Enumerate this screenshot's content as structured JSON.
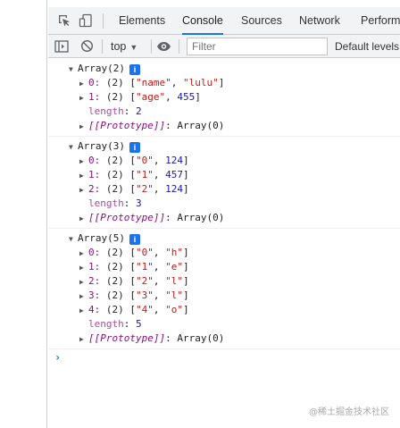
{
  "tabs": {
    "elements": "Elements",
    "console": "Console",
    "sources": "Sources",
    "network": "Network",
    "performance": "Perform"
  },
  "toolbar": {
    "context": "top",
    "filter_placeholder": "Filter",
    "levels": "Default levels"
  },
  "log1": {
    "header": "Array(2)",
    "info": "i",
    "item0": {
      "index": "0:",
      "count": " (2) [",
      "a": "\"name\"",
      "sep": ", ",
      "b": "\"lulu\"",
      "close": "]"
    },
    "item1": {
      "index": "1:",
      "count": " (2) [",
      "a": "\"age\"",
      "sep": ", ",
      "b": "455",
      "close": "]"
    },
    "length_key": "length",
    "colon": ": ",
    "length_val": "2",
    "proto_key": "[[Prototype]]",
    "proto_val": ": Array(0)"
  },
  "log2": {
    "header": "Array(3)",
    "info": "i",
    "item0": {
      "index": "0:",
      "count": " (2) [",
      "a": "\"0\"",
      "sep": ", ",
      "b": "124",
      "close": "]"
    },
    "item1": {
      "index": "1:",
      "count": " (2) [",
      "a": "\"1\"",
      "sep": ", ",
      "b": "457",
      "close": "]"
    },
    "item2": {
      "index": "2:",
      "count": " (2) [",
      "a": "\"2\"",
      "sep": ", ",
      "b": "124",
      "close": "]"
    },
    "length_key": "length",
    "colon": ": ",
    "length_val": "3",
    "proto_key": "[[Prototype]]",
    "proto_val": ": Array(0)"
  },
  "log3": {
    "header": "Array(5)",
    "info": "i",
    "item0": {
      "index": "0:",
      "count": " (2) [",
      "a": "\"0\"",
      "sep": ", ",
      "b": "\"h\"",
      "close": "]"
    },
    "item1": {
      "index": "1:",
      "count": " (2) [",
      "a": "\"1\"",
      "sep": ", ",
      "b": "\"e\"",
      "close": "]"
    },
    "item2": {
      "index": "2:",
      "count": " (2) [",
      "a": "\"2\"",
      "sep": ", ",
      "b": "\"l\"",
      "close": "]"
    },
    "item3": {
      "index": "3:",
      "count": " (2) [",
      "a": "\"3\"",
      "sep": ", ",
      "b": "\"l\"",
      "close": "]"
    },
    "item4": {
      "index": "4:",
      "count": " (2) [",
      "a": "\"4\"",
      "sep": ", ",
      "b": "\"o\"",
      "close": "]"
    },
    "length_key": "length",
    "colon": ": ",
    "length_val": "5",
    "proto_key": "[[Prototype]]",
    "proto_val": ": Array(0)"
  },
  "prompt": "›",
  "watermark": "@稀土掘金技术社区",
  "icons": [
    "inspect-icon",
    "device-toggle-icon",
    "sidebar-toggle-icon",
    "clear-console-icon",
    "eye-icon",
    "expand-arrow-icon",
    "collapse-arrow-icon",
    "info-icon"
  ],
  "colors": {
    "accent": "#1a73e8",
    "key": "#881280",
    "string": "#c41a16",
    "number": "#1a1aa6",
    "toolbar": "#f1f3f4"
  }
}
